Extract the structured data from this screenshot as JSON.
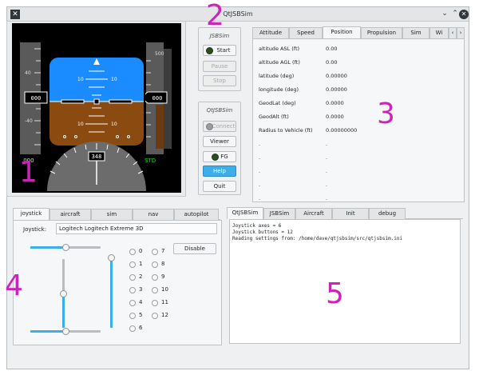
{
  "window": {
    "title": "QtJSBSim",
    "minimize": "⌄",
    "maximize": "⌃",
    "close": "✕"
  },
  "annotations": {
    "a1": "1",
    "a2": "2",
    "a3": "3",
    "a4": "4",
    "a5": "5"
  },
  "pfd": {
    "altitude_top": "500",
    "altitude_value": "000",
    "speed_value": "000",
    "vspeed": ".000",
    "baro": "STD",
    "heading": "348",
    "pitch_labels": {
      "p10": "10",
      "m10": "10"
    }
  },
  "jsbsim_group": {
    "title": "JSBSim",
    "start": "Start",
    "pause": "Pause",
    "stop": "Stop"
  },
  "qtjsbsim_group": {
    "title": "QtJSBSim",
    "connect": "Connect",
    "viewer": "Viewer",
    "fg": "FG",
    "help": "Help",
    "quit": "Quit"
  },
  "prop_tabs": {
    "tabs": [
      "Attitude",
      "Speed",
      "Position",
      "Propulsion",
      "Sim",
      "Wi"
    ],
    "active": "Position",
    "scroll_left": "‹",
    "scroll_right": "›",
    "rows": [
      {
        "label": "altitude ASL (ft)",
        "value": "0.00"
      },
      {
        "label": "altitude AGL (ft)",
        "value": "0.00"
      },
      {
        "label": "latitude (deg)",
        "value": "0.00000"
      },
      {
        "label": "longitude (deg)",
        "value": "0.00000"
      },
      {
        "label": "GeodLat (deg)",
        "value": "0.0000"
      },
      {
        "label": "GeodAlt (ft)",
        "value": "0.0000"
      },
      {
        "label": "Radius to Vehicle (ft)",
        "value": "0.00000000"
      },
      {
        "label": ".",
        "value": "."
      },
      {
        "label": ".",
        "value": "."
      },
      {
        "label": ".",
        "value": "."
      },
      {
        "label": ".",
        "value": "."
      },
      {
        "label": ".",
        "value": "."
      }
    ]
  },
  "control_tabs": {
    "tabs": [
      "joystick",
      "aircraft",
      "sim",
      "nav",
      "autopilot"
    ],
    "active": "joystick",
    "joystick_label": "Joystick:",
    "joystick_name": "Logitech Logitech Extreme 3D",
    "disable": "Disable",
    "buttons_left": [
      "0",
      "1",
      "2",
      "3",
      "4",
      "5",
      "6"
    ],
    "buttons_right": [
      "7",
      "8",
      "9",
      "10",
      "11",
      "12"
    ],
    "slider_top": 0.5,
    "slider_bottom": 0.5,
    "slider_vert1": 0.5,
    "slider_vert2": 1.0
  },
  "log_tabs": {
    "tabs": [
      "QtJSBSim",
      "JSBSim",
      "Aircraft",
      "Init",
      "debug"
    ],
    "active": "QtJSBSim",
    "lines": [
      "Joystick axes = 6",
      "Joystick buttons = 12",
      "Reading settings from: /home/dave/qtjsbsim/src/qtjsbsim.ini"
    ]
  },
  "colors": {
    "sky": "#1a8cff",
    "ground": "#8a4a10",
    "accent": "#3daee9",
    "annotation": "#c926b9"
  }
}
